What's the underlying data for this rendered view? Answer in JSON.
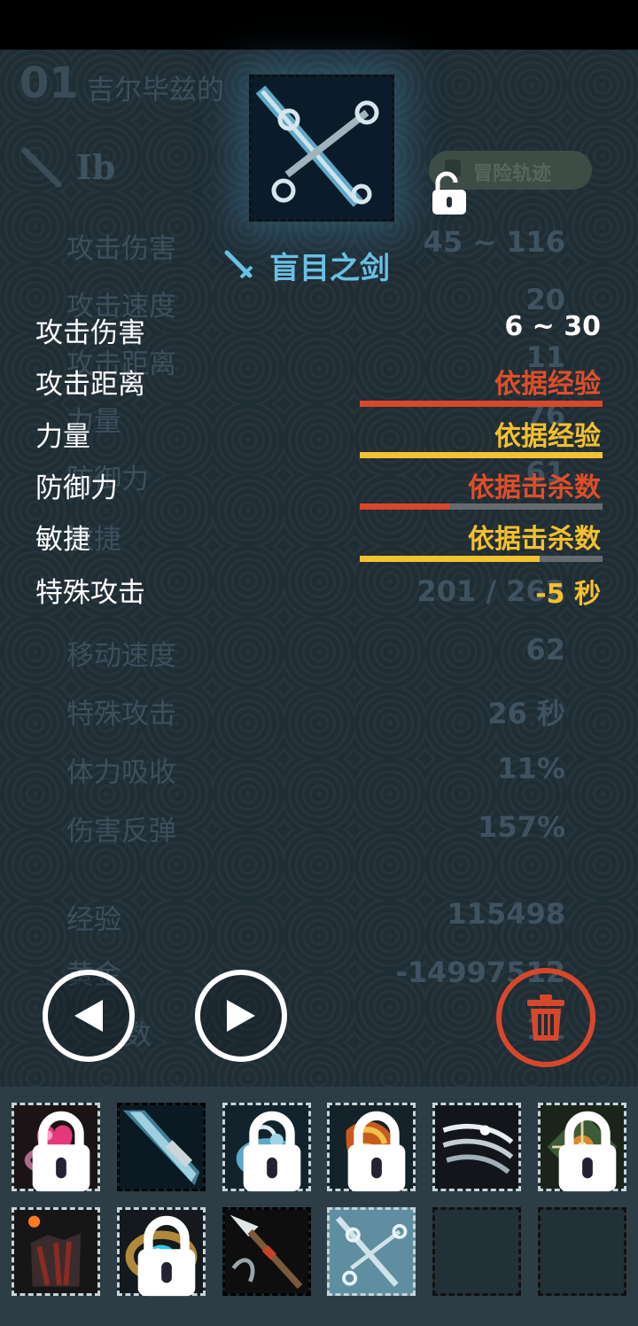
{
  "background_panel": {
    "index": "01",
    "name": "吉尔毕兹的",
    "level": "Ib",
    "tag": "冒险轨迹",
    "stats": [
      {
        "label": "攻击伤害",
        "value": "45 ~ 116"
      },
      {
        "label": "攻击速度",
        "value": "20"
      },
      {
        "label": "攻击距离",
        "value": "11"
      },
      {
        "label": "力量",
        "value": "76"
      },
      {
        "label": "防御力",
        "value": "61"
      },
      {
        "label": "敏捷",
        "value": ""
      },
      {
        "label": "",
        "value": "201 / 262"
      },
      {
        "label": "移动速度",
        "value": "62"
      },
      {
        "label": "特殊攻击",
        "value": "26 秒"
      },
      {
        "label": "体力吸收",
        "value": "11%"
      },
      {
        "label": "伤害反弹",
        "value": "157%"
      },
      {
        "label": "经验",
        "value": "115498"
      },
      {
        "label": "黄金",
        "value": "-14997512"
      },
      {
        "label": "数",
        "value": "11"
      }
    ]
  },
  "item": {
    "name": "盲目之剑",
    "icon": "sword-icon",
    "locked": false,
    "stats": [
      {
        "label": "攻击伤害",
        "value": "6 ~ 30",
        "color": "#ffffff"
      },
      {
        "label": "攻击距离",
        "value": "依据经验",
        "color": "#e04e28",
        "bar_color": "#d9472a",
        "progress": 1.0
      },
      {
        "label": "力量",
        "value": "依据经验",
        "color": "#f5c02c",
        "bar_color": "#f2c231",
        "progress": 1.0
      },
      {
        "label": "防御力",
        "value": "依据击杀数",
        "color": "#e04e28",
        "bar_color": "#d9472a",
        "progress": 0.37
      },
      {
        "label": "敏捷",
        "value": "依据击杀数",
        "color": "#f5c02c",
        "bar_color": "#f2c231",
        "progress": 0.74
      },
      {
        "label": "特殊攻击",
        "value": "-5 秒",
        "color": "#f5c02c"
      }
    ]
  },
  "buttons": {
    "prev": "left-arrow-icon",
    "next": "right-arrow-icon",
    "delete": "trash-icon"
  },
  "inventory": [
    {
      "icon": "heart-ring-icon",
      "locked": true
    },
    {
      "icon": "blade-icon",
      "locked": false
    },
    {
      "icon": "blue-ring-icon",
      "locked": true
    },
    {
      "icon": "gauntlet-icon",
      "locked": true
    },
    {
      "icon": "claw-icon",
      "locked": false
    },
    {
      "icon": "amulet-icon",
      "locked": true
    },
    {
      "icon": "fire-armor-icon",
      "locked": false
    },
    {
      "icon": "gem-ring-icon",
      "locked": true
    },
    {
      "icon": "spear-icon",
      "locked": false
    },
    {
      "icon": "sword-icon",
      "locked": false,
      "selected": true
    },
    {
      "icon": "empty-slot",
      "locked": false
    },
    {
      "icon": "empty-slot",
      "locked": false
    }
  ]
}
